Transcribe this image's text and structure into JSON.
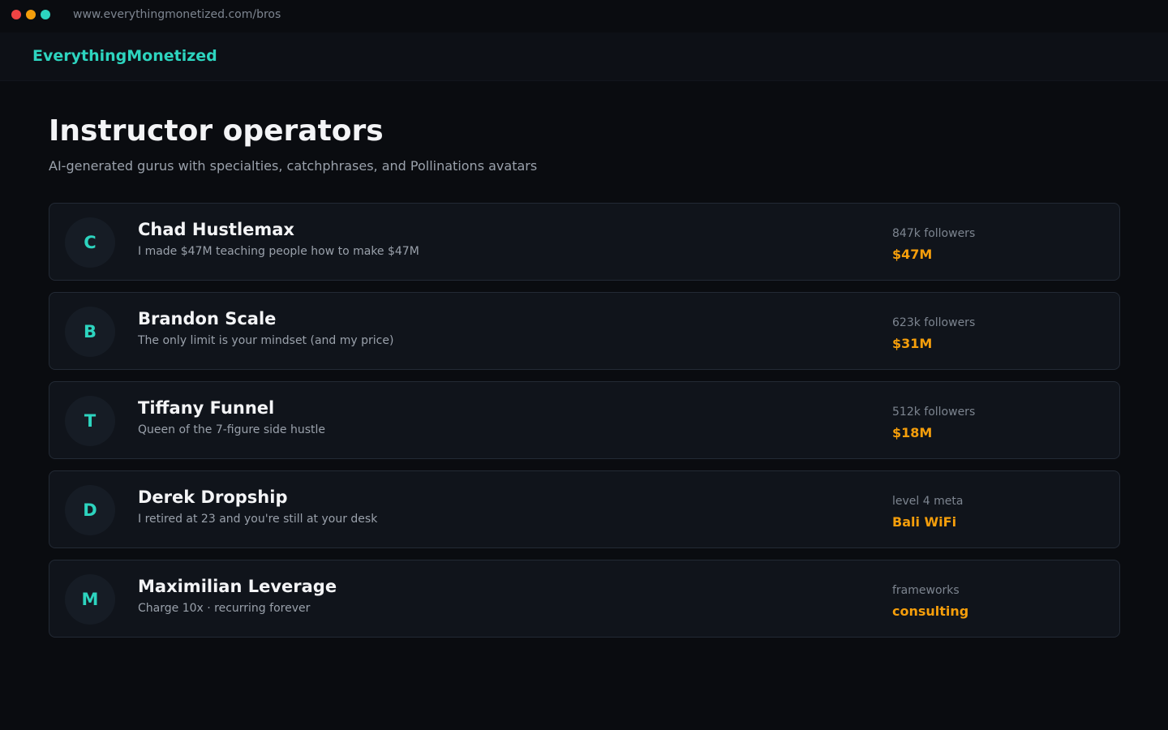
{
  "browser": {
    "url": "www.everythingmonetized.com/bros",
    "dot_colors": [
      "#ef4444",
      "#f59e0b",
      "#2dd4bf"
    ]
  },
  "header": {
    "brand": "EverythingMonetized"
  },
  "main": {
    "title": "Instructor operators",
    "subtitle": "AI-generated gurus with specialties, catchphrases, and Pollinations avatars"
  },
  "instructors": [
    {
      "initial": "C",
      "name": "Chad Hustlemax",
      "tagline": "I made $47M teaching people how to make $47M",
      "stat_label": "847k followers",
      "stat_value": "$47M"
    },
    {
      "initial": "B",
      "name": "Brandon Scale",
      "tagline": "The only limit is your mindset (and my price)",
      "stat_label": "623k followers",
      "stat_value": "$31M"
    },
    {
      "initial": "T",
      "name": "Tiffany Funnel",
      "tagline": "Queen of the 7-figure side hustle",
      "stat_label": "512k followers",
      "stat_value": "$18M"
    },
    {
      "initial": "D",
      "name": "Derek Dropship",
      "tagline": "I retired at 23 and you're still at your desk",
      "stat_label": "level 4 meta",
      "stat_value": "Bali WiFi"
    },
    {
      "initial": "M",
      "name": "Maximilian Leverage",
      "tagline": "Charge 10x · recurring forever",
      "stat_label": "frameworks",
      "stat_value": "consulting"
    }
  ],
  "colors": {
    "accent": "#2dd4bf",
    "highlight": "#f59e0b",
    "background": "#0a0c10",
    "card": "#10141b"
  }
}
